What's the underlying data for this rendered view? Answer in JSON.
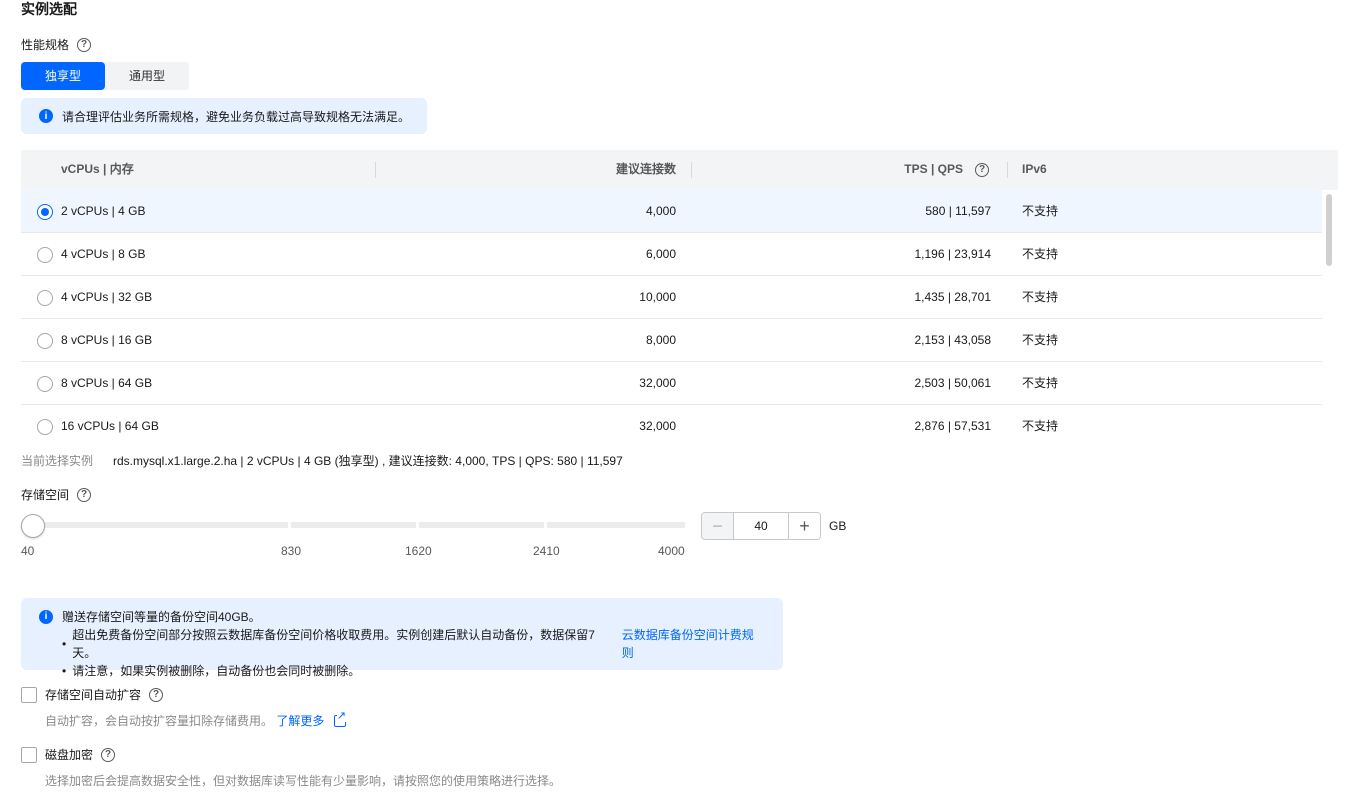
{
  "section_title": "实例选配",
  "performance": {
    "label": "性能规格",
    "tabs": [
      {
        "label": "独享型",
        "active": true
      },
      {
        "label": "通用型",
        "active": false
      }
    ],
    "alert": "请合理评估业务所需规格，避免业务负载过高导致规格无法满足。"
  },
  "table": {
    "headers": [
      "vCPUs | 内存",
      "建议连接数",
      "TPS | QPS",
      "IPv6"
    ],
    "rows": [
      {
        "spec": "2 vCPUs | 4 GB",
        "connections": "4,000",
        "tps_qps": "580 | 11,597",
        "ipv6": "不支持",
        "selected": true
      },
      {
        "spec": "4 vCPUs | 8 GB",
        "connections": "6,000",
        "tps_qps": "1,196 | 23,914",
        "ipv6": "不支持",
        "selected": false
      },
      {
        "spec": "4 vCPUs | 32 GB",
        "connections": "10,000",
        "tps_qps": "1,435 | 28,701",
        "ipv6": "不支持",
        "selected": false
      },
      {
        "spec": "8 vCPUs | 16 GB",
        "connections": "8,000",
        "tps_qps": "2,153 | 43,058",
        "ipv6": "不支持",
        "selected": false
      },
      {
        "spec": "8 vCPUs | 64 GB",
        "connections": "32,000",
        "tps_qps": "2,503 | 50,061",
        "ipv6": "不支持",
        "selected": false
      },
      {
        "spec": "16 vCPUs | 64 GB",
        "connections": "32,000",
        "tps_qps": "2,876 | 57,531",
        "ipv6": "不支持",
        "selected": false
      }
    ]
  },
  "current": {
    "label": "当前选择实例",
    "value": "rds.mysql.x1.large.2.ha | 2 vCPUs | 4 GB (独享型) , 建议连接数: 4,000, TPS | QPS: 580 | 11,597"
  },
  "storage": {
    "label": "存储空间",
    "slider_ticks": [
      "40",
      "830",
      "1620",
      "2410",
      "4000"
    ],
    "slider_level": 0,
    "value": "40",
    "unit": "GB"
  },
  "backup_alert": {
    "title": "赠送存储空间等量的备份空间40GB。",
    "bullet1": "超出免费备份空间部分按照云数据库备份空间价格收取费用。实例创建后默认自动备份，数据保留7天。",
    "bullet1_link": "云数据库备份空间计费规则",
    "bullet2": "请注意，如果实例被删除，自动备份也会同时被删除。"
  },
  "auto_expand": {
    "label": "存储空间自动扩容",
    "desc": "自动扩容，会自动按扩容量扣除存储费用。",
    "link": "了解更多"
  },
  "encryption": {
    "label": "磁盘加密",
    "desc": "选择加密后会提高数据安全性，但对数据库读写性能有少量影响，请按照您的使用策略进行选择。"
  },
  "colors": {
    "accent": "#0066ff",
    "alert_bg": "#e6f0ff"
  }
}
